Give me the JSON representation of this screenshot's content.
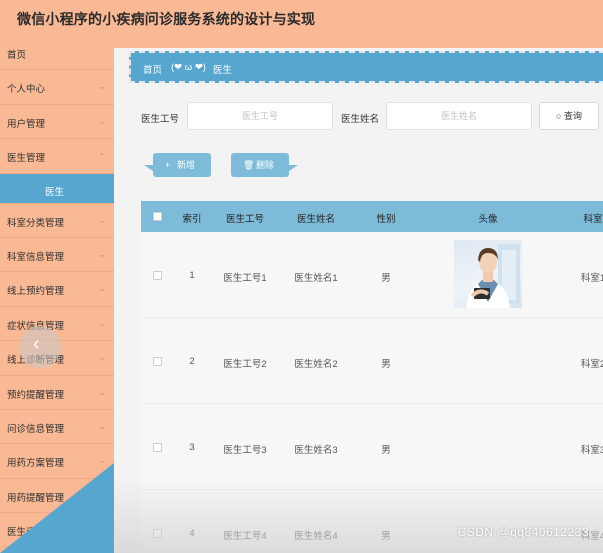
{
  "app": {
    "title": "微信小程序的小疾病问诊服务系统的设计与实现"
  },
  "sidebar": {
    "items": [
      {
        "label": "首页",
        "has_chevron": false
      },
      {
        "label": "个人中心",
        "has_chevron": true
      },
      {
        "label": "用户管理",
        "has_chevron": true
      },
      {
        "label": "医生管理",
        "has_chevron": true
      },
      {
        "label": "医生",
        "sub": true
      },
      {
        "label": "科室分类管理",
        "has_chevron": true
      },
      {
        "label": "科室信息管理",
        "has_chevron": true
      },
      {
        "label": "线上预约管理",
        "has_chevron": true
      },
      {
        "label": "症状信息管理",
        "has_chevron": true
      },
      {
        "label": "线上诊断管理",
        "has_chevron": true
      },
      {
        "label": "预约提醒管理",
        "has_chevron": true
      },
      {
        "label": "问诊信息管理",
        "has_chevron": true
      },
      {
        "label": "用药方案管理",
        "has_chevron": true
      },
      {
        "label": "用药提醒管理",
        "has_chevron": true
      },
      {
        "label": "医生评价管理",
        "has_chevron": true
      }
    ],
    "chevron": "⌄",
    "slide_prev": "‹"
  },
  "breadcrumb": {
    "home": "首页",
    "face": "(❤ ω ❤)",
    "current": "医生"
  },
  "search": {
    "label_id": "医生工号",
    "placeholder_id": "医生工号",
    "label_name": "医生姓名",
    "placeholder_name": "医生姓名",
    "query_icon": "○",
    "query_label": "查询"
  },
  "actions": {
    "add_icon": "+",
    "add_label": "新增",
    "delete_icon": "🗑",
    "delete_label": "删除"
  },
  "table": {
    "columns": [
      "索引",
      "医生工号",
      "医生姓名",
      "性别",
      "头像",
      "科室"
    ],
    "rows": [
      {
        "index": "1",
        "doctor_id": "医生工号1",
        "doctor_name": "医生姓名1",
        "gender": "男",
        "dept": "科室1",
        "has_avatar": true
      },
      {
        "index": "2",
        "doctor_id": "医生工号2",
        "doctor_name": "医生姓名2",
        "gender": "男",
        "dept": "科室2",
        "has_avatar": false
      },
      {
        "index": "3",
        "doctor_id": "医生工号3",
        "doctor_name": "医生姓名3",
        "gender": "男",
        "dept": "科室3",
        "has_avatar": false
      },
      {
        "index": "4",
        "doctor_id": "医生工号4",
        "doctor_name": "医生姓名4",
        "gender": "男",
        "dept": "科室4",
        "has_avatar": false
      }
    ]
  },
  "watermark": "CSDN @qq840612233",
  "colors": {
    "peach": "#f9b995",
    "blue": "#56a6cf",
    "light_blue": "#7dbbd9"
  }
}
